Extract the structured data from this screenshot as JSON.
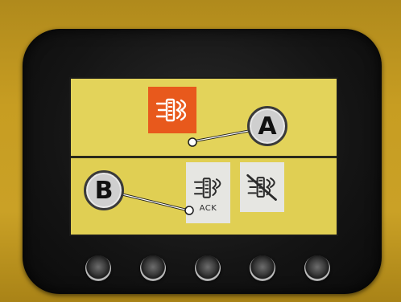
{
  "display": {
    "alarm_icon": "proximity-sensor-alarm-icon",
    "alarm_color": "#e8591c",
    "screen_color": "#e0cf56",
    "softkeys": [
      {
        "icon": "proximity-sensor-acknowledge-icon",
        "label": "ACK"
      },
      {
        "icon": "proximity-sensor-disabled-icon"
      }
    ]
  },
  "callouts": {
    "a": "A",
    "b": "B"
  },
  "hardware": {
    "button_count": 5
  }
}
